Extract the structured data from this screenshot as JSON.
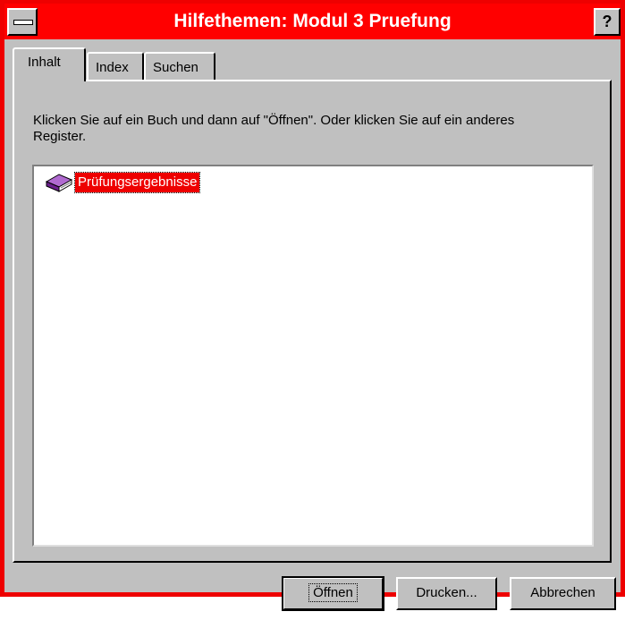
{
  "window": {
    "title": "Hilfethemen: Modul 3 Pruefung",
    "help_glyph": "?",
    "accent_color": "#ff0000"
  },
  "tabs": [
    {
      "label": "Inhalt",
      "active": true
    },
    {
      "label": "Index",
      "active": false
    },
    {
      "label": "Suchen",
      "active": false
    }
  ],
  "instructions": "Klicken Sie auf ein Buch und dann auf \"Öffnen\". Oder klicken Sie auf ein anderes Register.",
  "tree": {
    "items": [
      {
        "label": "Prüfungsergebnisse",
        "icon": "book-icon",
        "selected": true
      }
    ]
  },
  "buttons": {
    "open": "Öffnen",
    "print": "Drucken...",
    "cancel": "Abbrechen"
  }
}
